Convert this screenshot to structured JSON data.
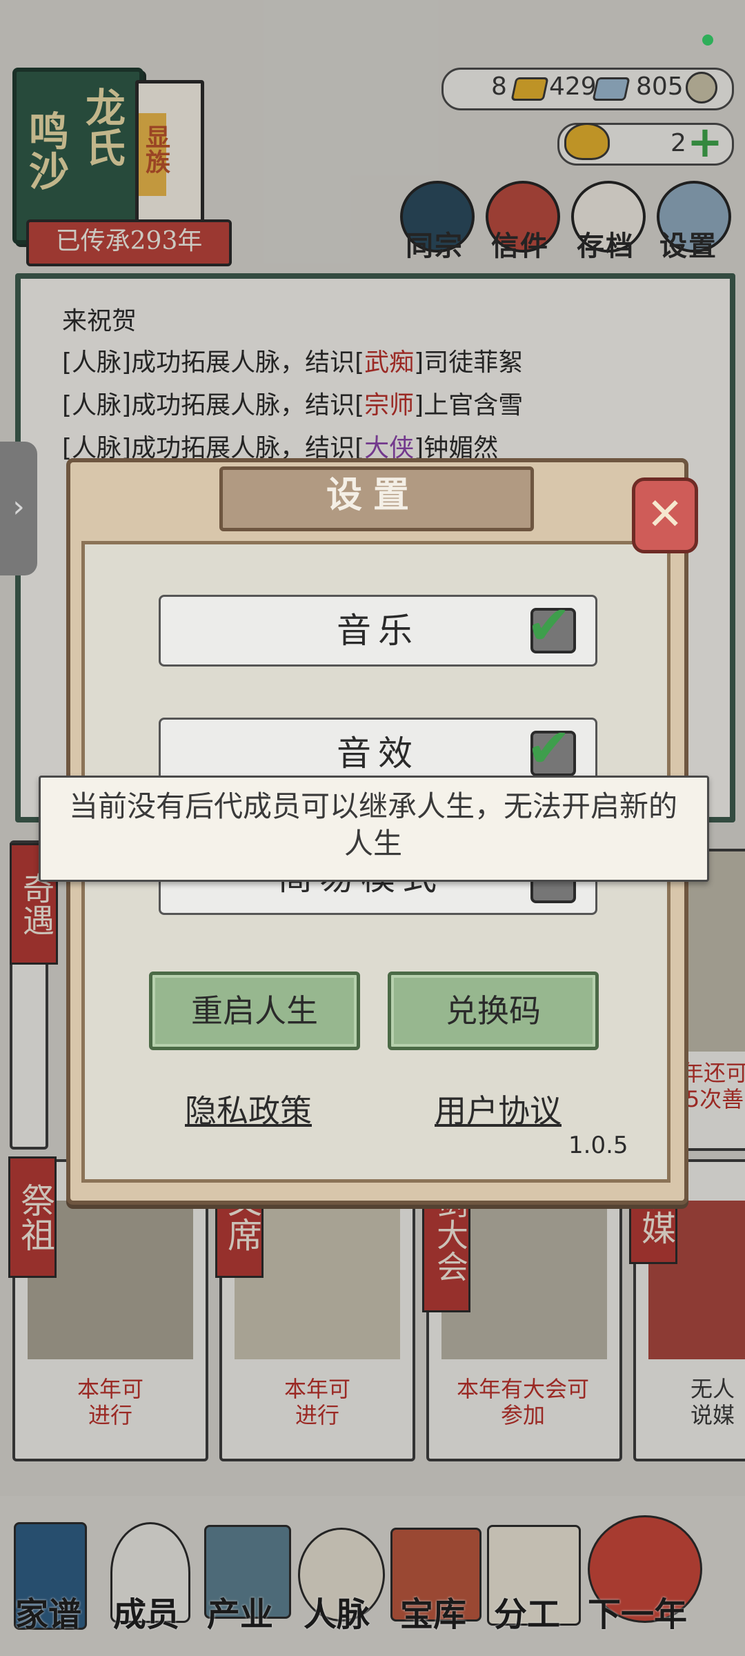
{
  "family": {
    "name_main": "鸣沙",
    "name_clan": "龙氏",
    "side_tag": "显族",
    "inherit_label": "已传承293年"
  },
  "currencies": {
    "gold_count": "8",
    "silver_count": "429",
    "coin_count": "805",
    "yuanbao_count": "2"
  },
  "top_menu": [
    {
      "label": "同宗",
      "icon": "book-icon"
    },
    {
      "label": "信件",
      "icon": "letter-icon"
    },
    {
      "label": "存档",
      "icon": "brush-scroll-icon"
    },
    {
      "label": "设置",
      "icon": "gear-icon"
    }
  ],
  "log": {
    "line0": "来祝贺",
    "line1_prefix": "[人脉]成功拓展人脉，结识[",
    "line1_title": "武痴",
    "line1_suffix": "]司徒菲絮",
    "line2_prefix": "[人脉]成功拓展人脉，结识[",
    "line2_title": "宗师",
    "line2_suffix": "]上官含雪",
    "line3_prefix": "[人脉]成功拓展人脉，结识[",
    "line3_title": "大侠",
    "line3_suffix": "]钟媚然"
  },
  "cards": {
    "qiyu_tag": "奇遇",
    "qiyu_text": "年还可\n5次善",
    "jizu_tag": "祭祖",
    "jizu_text": "本年可\n进行",
    "wenxi_tag": "文席",
    "wenxi_text": "本年可\n进行",
    "lunjian_tag": "剑大会",
    "lunjian_text": "本年有大会可\n参加",
    "shuomei_tag": "说媒",
    "shuomei_text": "无人\n说媒"
  },
  "bottom_nav": [
    {
      "label": "家谱"
    },
    {
      "label": "成员"
    },
    {
      "label": "产业"
    },
    {
      "label": "人脉"
    },
    {
      "label": "宝库"
    },
    {
      "label": "分工"
    },
    {
      "label": "下一年"
    }
  ],
  "settings": {
    "title": "设置",
    "close_label": "✕",
    "music_label": "音乐",
    "music_checked": true,
    "sfx_label": "音效",
    "sfx_checked": true,
    "simple_label": "简易模式",
    "simple_checked": false,
    "restart_label": "重启人生",
    "redeem_label": "兑换码",
    "privacy_label": "隐私政策",
    "terms_label": "用户协议",
    "version": "1.0.5"
  },
  "toast": {
    "message": "当前没有后代成员可以继承人生，无法开启新的人生"
  },
  "colors": {
    "accent_red": "#b8322c",
    "accent_green": "#3e9e4c",
    "dialog_brown": "#6e5640"
  }
}
